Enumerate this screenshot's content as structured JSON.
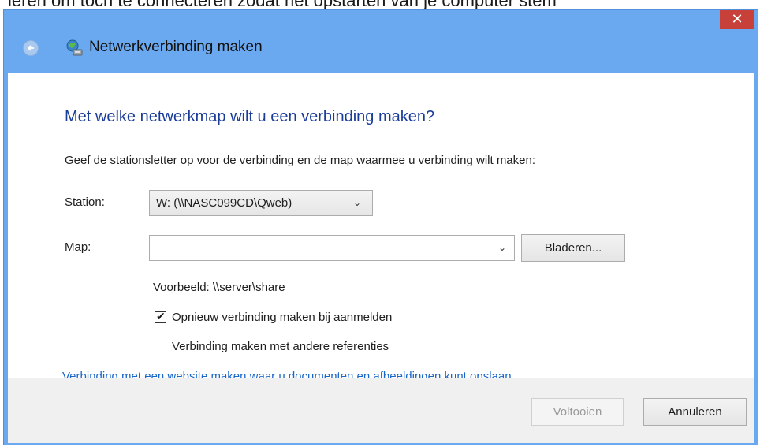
{
  "background": {
    "partial_text": "ieren om toch te connecteren zodat het opstarten van je computer stem"
  },
  "window": {
    "close_glyph": "✕",
    "title": "Netwerkverbinding maken",
    "heading": "Met welke netwerkmap wilt u een verbinding maken?",
    "instruction": "Geef de stationsletter op voor de verbinding en de map waarmee u verbinding wilt maken:"
  },
  "form": {
    "station_label": "Station:",
    "station_value": "W: (\\\\NASC099CD\\Qweb)",
    "map_label": "Map:",
    "map_value": "",
    "browse_label": "Bladeren...",
    "example": "Voorbeeld: \\\\server\\share",
    "reconnect_label": "Opnieuw verbinding maken bij aanmelden",
    "reconnect_checked": true,
    "other_credentials_label": "Verbinding maken met andere referenties",
    "other_credentials_checked": false,
    "website_link": "Verbinding met een website maken waar u documenten en afbeeldingen kunt opslaan",
    "website_link_suffix": "."
  },
  "footer": {
    "finish_label": "Voltooien",
    "cancel_label": "Annuleren"
  },
  "icons": {
    "back": "back-arrow-icon",
    "title": "network-drive-icon",
    "chevron": "chevron-down-icon",
    "check": "checkmark-icon"
  },
  "colors": {
    "titlebar": "#6aa8ef",
    "close": "#c7403a",
    "heading": "#1b3d9a",
    "link": "#1b66c9"
  }
}
